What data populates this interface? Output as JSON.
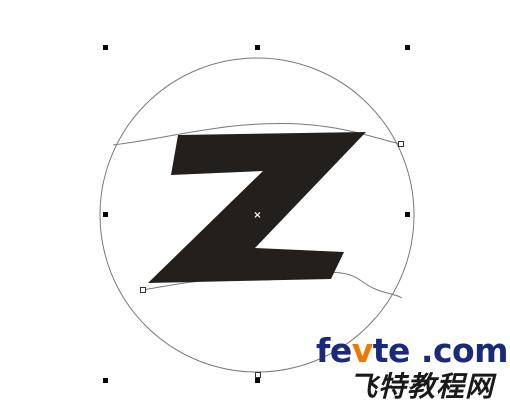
{
  "watermark": {
    "domain_prefix": "fe",
    "domain_accent": "v",
    "domain_suffix": "te .com",
    "chinese": "飞特教程网"
  },
  "colors": {
    "background": "#ffffff",
    "glyph_fill": "#231f1c",
    "outline": "#7a7a7a",
    "handle": "#000000",
    "watermark_main": "#1a2a7a",
    "watermark_accent": "#f07800",
    "watermark_cn": "#1a1a1a"
  },
  "icons": {
    "selection_handle": "square-handle-icon",
    "center_marker": "x-center-icon",
    "path_node": "node-point-icon"
  }
}
